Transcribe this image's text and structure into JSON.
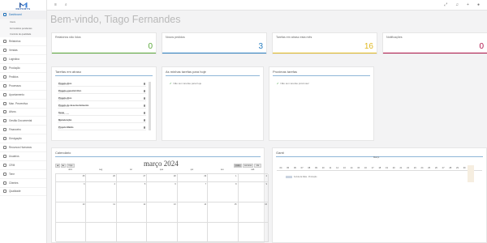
{
  "brand": "REPORTS",
  "sidebar": {
    "items": [
      "Dashboard",
      "Relatórios",
      "Vendas",
      "Logística",
      "Produção",
      "Pedidos",
      "Processos",
      "Apontamento",
      "Man. Preventiva",
      "Ativos",
      "Gestão Documental",
      "Financeiro",
      "Divulgação",
      "Recursos Humanos",
      "Usuários",
      "CRM",
      "Time",
      "Clientes",
      "Qualidade"
    ],
    "sub": [
      "Users",
      "Formulários pendentes",
      "Controle de qualidade"
    ]
  },
  "title": "Bem-vindo, Tiago Fernandes",
  "stats": [
    {
      "label": "Relatórios não lidos",
      "value": "0",
      "color": "#5aa83a"
    },
    {
      "label": "Novos pedidos",
      "value": "3",
      "color": "#2a7fc1"
    },
    {
      "label": "Tarefas em atraso esta mês",
      "value": "16",
      "color": "#e0b820"
    },
    {
      "label": "Notificações",
      "value": "0",
      "color": "#b0144a"
    }
  ],
  "panels": {
    "late": "Tarefas em atraso",
    "mine": "As minhas tarefas para hoje",
    "mine_empty": "Não tem tarefas para hoje",
    "next": "Proximas tarefas",
    "next_empty": "Não tem tarefas próximas!"
  },
  "tasks": [
    {
      "n": "Projeto Alvo",
      "s": "Relatório: nao"
    },
    {
      "n": "Projeto especial Alvo",
      "s": "Relatório: nao"
    },
    {
      "n": "Projeto Alvo",
      "s": "Relatório: nao"
    },
    {
      "n": "Projeto de desenvolvimento",
      "s": "Relatório: nao"
    },
    {
      "n": "Teste",
      "s": "Relatório: nao"
    },
    {
      "n": "Manutenção",
      "s": "Pré"
    },
    {
      "n": "Projeto Médio",
      "s": "Pré"
    }
  ],
  "calendar": {
    "title": "Calendário",
    "month": "março 2024",
    "today": "hoje",
    "views": [
      "mês",
      "semana",
      "dia"
    ],
    "days": [
      "dom",
      "seg",
      "ter",
      "qua",
      "qui",
      "sex",
      "sáb"
    ],
    "dates": [
      "25",
      "26",
      "27",
      "28",
      "29",
      "1",
      "2",
      "3",
      "4",
      "5",
      "6",
      "7",
      "8",
      "9",
      "10",
      "11",
      "12",
      "13",
      "14",
      "15",
      "16"
    ]
  },
  "gantt": {
    "title": "Gantt",
    "month": "Março",
    "days": [
      "04",
      "05",
      "06",
      "07",
      "08",
      "09",
      "10",
      "11",
      "12",
      "13",
      "14",
      "15",
      "16",
      "17",
      "18",
      "19",
      "20",
      "21",
      "22",
      "23",
      "24",
      "25",
      "26",
      "27",
      "28",
      "29",
      "30",
      "31"
    ],
    "task": "Ferida da Maia - Produção"
  }
}
